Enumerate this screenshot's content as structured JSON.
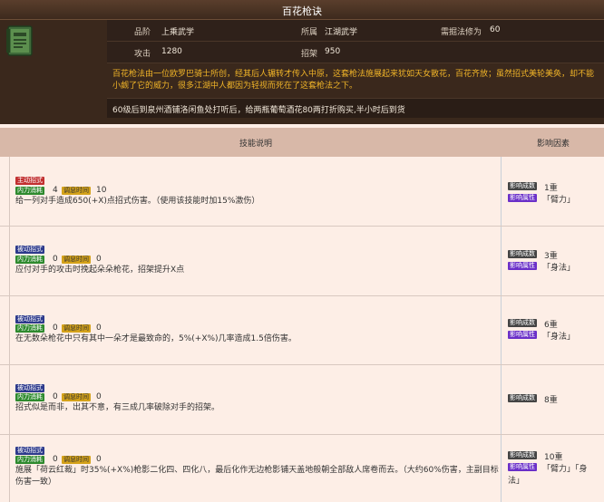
{
  "skill": {
    "title": "百花枪诀",
    "grade_label": "品阶",
    "grade_value": "上乘武学",
    "school_label": "所属",
    "school_value": "江湖武学",
    "req_label": "需掘法修为",
    "req_value": "60",
    "attack_label": "攻击",
    "attack_value": "1280",
    "parry_label": "招架",
    "parry_value": "950",
    "description": "百花枪法由一位欧罗巴骑士所创，经其后人辗转才传入中原，这套枪法施展起来犹如天女散花，百花齐放；虽然招式美轮美奂，却不能小觑了它的威力，很多江湖中人都因为轻视而死在了这套枪法之下。",
    "note": "60级后到泉州酒铺洛闲鱼处打听后，给两瓶葡萄酒花80两打折购买,半小时后到货"
  },
  "table": {
    "header_desc": "技能说明",
    "header_effect": "影响因素"
  },
  "labels": {
    "neili": "内力消耗",
    "cooldown": "调息时间",
    "dep": "影响成数",
    "attr": "影响属性"
  },
  "rows": [
    {
      "type": "主动招式",
      "neili": "4",
      "cooldown": "10",
      "text": "给一列对手造成650(+X)点招式伤害。（使用该技能时加15%激伤）",
      "text2": "",
      "dep": "1重",
      "attr": "「臂力」",
      "attr2": ""
    },
    {
      "type": "被动招式",
      "neili": "0",
      "cooldown": "0",
      "text": "应付对手的攻击时挽起朵朵枪花，招架提升X点",
      "text2": "",
      "dep": "3重",
      "attr": "「身法」",
      "attr2": ""
    },
    {
      "type": "被动招式",
      "neili": "0",
      "cooldown": "0",
      "text": "在无数朵枪花中只有其中一朵才是最致命的，5%(+X%)几率造成1.5倍伤害。",
      "text2": "",
      "dep": "6重",
      "attr": "「身法」",
      "attr2": ""
    },
    {
      "type": "被动招式",
      "neili": "0",
      "cooldown": "0",
      "text": "招式似是而非，出其不意，有三成几率破除对手的招架。",
      "text2": "",
      "dep": "8重",
      "attr": "",
      "attr2": ""
    },
    {
      "type": "被动招式",
      "neili": "0",
      "cooldown": "0",
      "text": "施展「荷云红裁」时35%(+X%)枪影二化四、四化八，最后化作无边枪影铺天盖地般朝全部敌人席卷而去。（大约60%伤害，主副目标",
      "text2": "伤害一致）",
      "dep": "10重",
      "attr": "「臂力」「身",
      "attr2": "法」"
    }
  ]
}
